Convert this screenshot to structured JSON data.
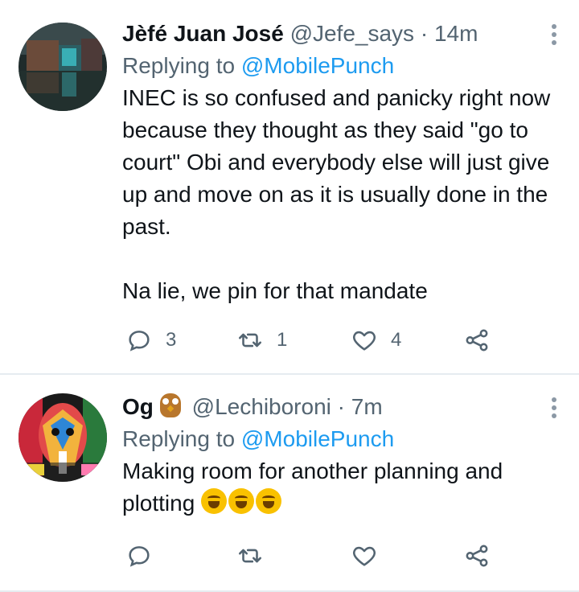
{
  "tweets": [
    {
      "name": "Jèfé Juan José",
      "handle": "@Jefe_says",
      "separator": "·",
      "time": "14m",
      "replying_prefix": "Replying to ",
      "replying_to": "@MobilePunch",
      "text": "INEC is so confused and panicky right now because they thought as they said \"go to court\" Obi and everybody else will just give up and move on as it is usually done in the past.\n\nNa lie, we pin for that mandate",
      "counts": {
        "replies": "3",
        "retweets": "1",
        "likes": "4"
      }
    },
    {
      "name": "Og",
      "name_emoji": "owl-emoji",
      "handle": "@Lechiboroni",
      "separator": "·",
      "time": "7m",
      "replying_prefix": "Replying to ",
      "replying_to": "@MobilePunch",
      "text": "Making room for another planning and plotting",
      "text_emoji": [
        "rolling-on-floor-laughing-emoji",
        "rolling-on-floor-laughing-emoji",
        "rolling-on-floor-laughing-emoji"
      ],
      "counts": {
        "replies": "",
        "retweets": "",
        "likes": ""
      }
    }
  ],
  "colors": {
    "accent": "#1d9bf0",
    "muted": "#536471",
    "text": "#0f1419",
    "divider": "#e6ecf0"
  },
  "icons": [
    "reply-icon",
    "retweet-icon",
    "like-icon",
    "share-icon",
    "more-icon"
  ]
}
